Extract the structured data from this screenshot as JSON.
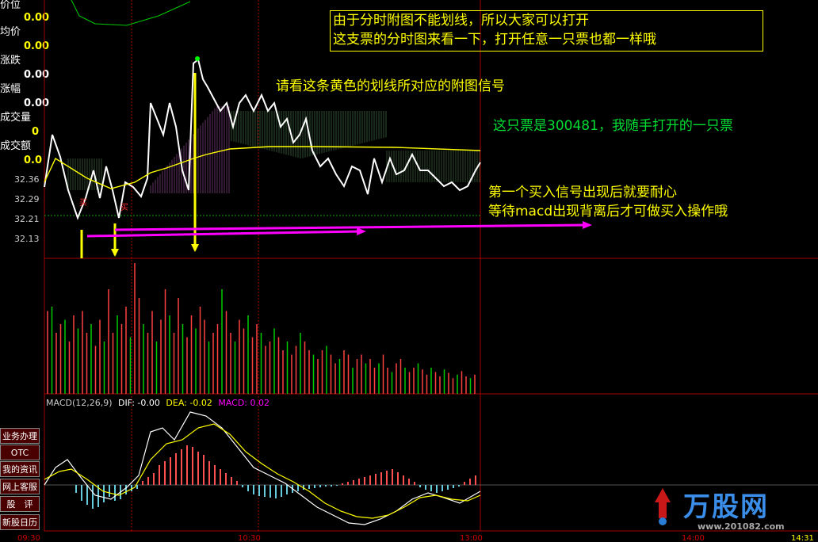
{
  "sidebar": {
    "price_label": "价位",
    "price_value": "0.00",
    "avg_label": "均价",
    "avg_value": "0.00",
    "change_label": "涨跌",
    "change_value": "0.00",
    "pct_label": "涨幅",
    "pct_value": "0.00",
    "vol_label": "成交量",
    "vol_value": "0",
    "amount_label": "成交额",
    "amount_value": "0",
    "zero_value": "0.0",
    "prices": [
      "32.36",
      "32.29",
      "32.21",
      "32.13"
    ]
  },
  "buttons": [
    "业务办理",
    "OTC",
    "我的资讯",
    "网上客服",
    "股　评",
    "新股日历"
  ],
  "annotations": {
    "box_line1": "由于分时附图不能划线，所以大家可以打开",
    "box_line2": "这支票的分时图来看一下，打开任意一只票也都一样哦",
    "yellow_line": "请看这条黄色的划线所对应的附图信号",
    "stock_note": "这只票是300481，我随手打开的一只票",
    "signal_line1": "第一个买入信号出现后就要耐心",
    "signal_line2": "等待macd出现背离后才可做买入操作哦",
    "buy1": "买",
    "buy2": "买"
  },
  "macd": {
    "title": "MACD(12,26,9)",
    "dif": "DIF: -0.00",
    "dea": "DEA: -0.02",
    "macd": "MACD: 0.02"
  },
  "time_axis": [
    "09:30",
    "10:30",
    "13:00",
    "14:00",
    "14:31"
  ],
  "watermark": {
    "brand": "万股网",
    "url": "www.201082.com"
  },
  "colors": {
    "price_line": "#ffffff",
    "avg_line": "#ffff00",
    "up": "#ff4040",
    "down": "#00cc00",
    "grid": "#aa0000",
    "arrow": "#ff00ff"
  }
}
